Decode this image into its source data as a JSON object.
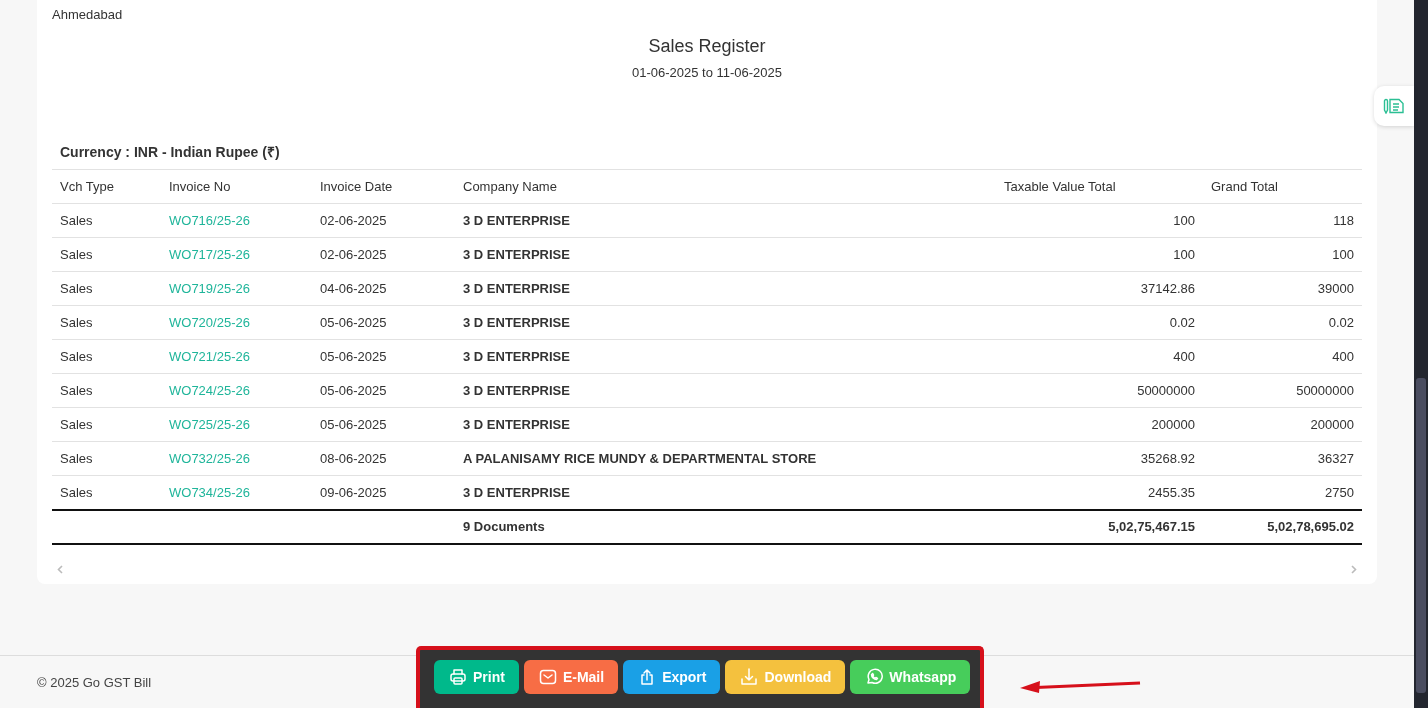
{
  "report": {
    "location": "Ahmedabad",
    "title": "Sales Register",
    "period": "01-06-2025 to 11-06-2025",
    "currency": "Currency : INR - Indian Rupee (₹)"
  },
  "table": {
    "columns": [
      "Vch Type",
      "Invoice No",
      "Invoice Date",
      "Company Name",
      "Taxable Value Total",
      "Grand Total"
    ],
    "rows": [
      {
        "vch_type": "Sales",
        "invoice_no": "WO716/25-26",
        "invoice_date": "02-06-2025",
        "company_name": "3 D ENTERPRISE",
        "taxable_value_total": "100",
        "grand_total": "118"
      },
      {
        "vch_type": "Sales",
        "invoice_no": "WO717/25-26",
        "invoice_date": "02-06-2025",
        "company_name": "3 D ENTERPRISE",
        "taxable_value_total": "100",
        "grand_total": "100"
      },
      {
        "vch_type": "Sales",
        "invoice_no": "WO719/25-26",
        "invoice_date": "04-06-2025",
        "company_name": "3 D ENTERPRISE",
        "taxable_value_total": "37142.86",
        "grand_total": "39000"
      },
      {
        "vch_type": "Sales",
        "invoice_no": "WO720/25-26",
        "invoice_date": "05-06-2025",
        "company_name": "3 D ENTERPRISE",
        "taxable_value_total": "0.02",
        "grand_total": "0.02"
      },
      {
        "vch_type": "Sales",
        "invoice_no": "WO721/25-26",
        "invoice_date": "05-06-2025",
        "company_name": "3 D ENTERPRISE",
        "taxable_value_total": "400",
        "grand_total": "400"
      },
      {
        "vch_type": "Sales",
        "invoice_no": "WO724/25-26",
        "invoice_date": "05-06-2025",
        "company_name": "3 D ENTERPRISE",
        "taxable_value_total": "50000000",
        "grand_total": "50000000"
      },
      {
        "vch_type": "Sales",
        "invoice_no": "WO725/25-26",
        "invoice_date": "05-06-2025",
        "company_name": "3 D ENTERPRISE",
        "taxable_value_total": "200000",
        "grand_total": "200000"
      },
      {
        "vch_type": "Sales",
        "invoice_no": "WO732/25-26",
        "invoice_date": "08-06-2025",
        "company_name": "A PALANISAMY RICE MUNDY & DEPARTMENTAL STORE",
        "taxable_value_total": "35268.92",
        "grand_total": "36327"
      },
      {
        "vch_type": "Sales",
        "invoice_no": "WO734/25-26",
        "invoice_date": "09-06-2025",
        "company_name": "3 D ENTERPRISE",
        "taxable_value_total": "2455.35",
        "grand_total": "2750"
      }
    ],
    "totals": {
      "documents": "9 Documents",
      "taxable_value_total": "5,02,75,467.15",
      "grand_total": "5,02,78,695.02"
    }
  },
  "footer": {
    "copyright": "© 2025 Go GST Bill"
  },
  "toolbar": {
    "buttons": [
      {
        "kind": "print",
        "label": "Print"
      },
      {
        "kind": "email",
        "label": "E-Mail"
      },
      {
        "kind": "export",
        "label": "Export"
      },
      {
        "kind": "download",
        "label": "Download"
      },
      {
        "kind": "whatsapp",
        "label": "Whatsapp"
      }
    ]
  }
}
